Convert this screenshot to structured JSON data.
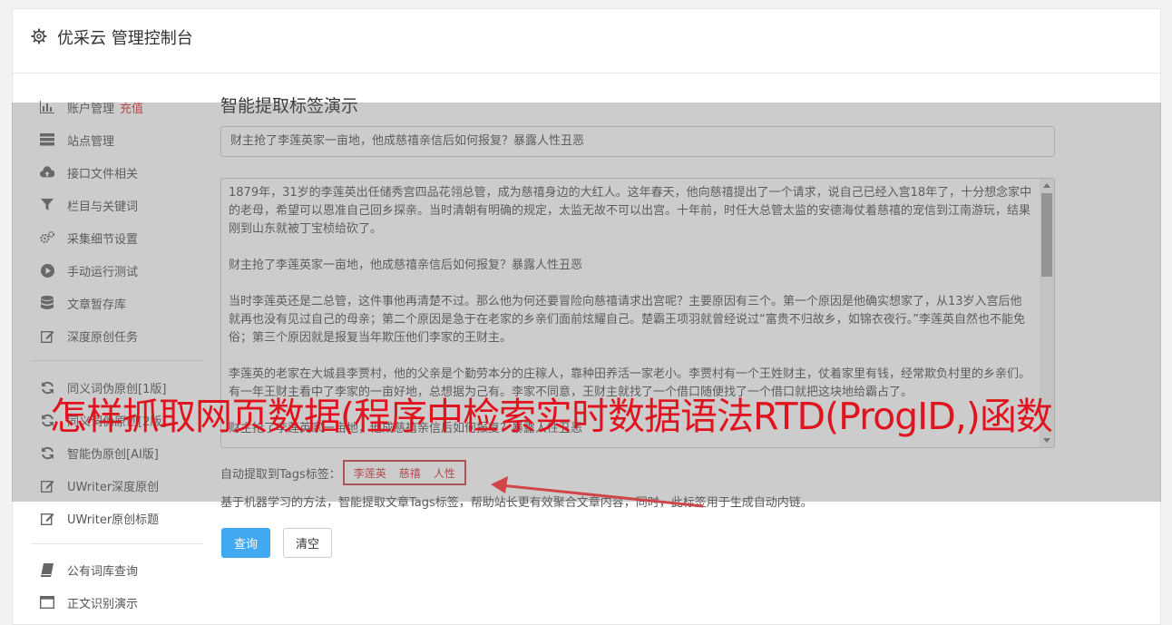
{
  "header": {
    "title": "优采云 管理控制台",
    "icon": "gear-icon"
  },
  "sidebar": {
    "items": [
      {
        "label": "账户管理",
        "highlight": "充值",
        "icon": "bar-chart-icon"
      },
      {
        "label": "站点管理",
        "icon": "server-icon"
      },
      {
        "label": "接口文件相关",
        "icon": "cloud-upload-icon"
      },
      {
        "label": "栏目与关键词",
        "icon": "filter-icon"
      },
      {
        "label": "采集细节设置",
        "icon": "cogs-icon"
      },
      {
        "label": "手动运行测试",
        "icon": "play-circle-icon"
      },
      {
        "label": "文章暂存库",
        "icon": "database-icon"
      },
      {
        "label": "深度原创任务",
        "icon": "edit-icon"
      },
      {
        "label": "同义词伪原创[1版]",
        "icon": "refresh-icon"
      },
      {
        "label": "同义词伪原创[2版]",
        "icon": "refresh-icon"
      },
      {
        "label": "智能伪原创[AI版]",
        "icon": "refresh-icon"
      },
      {
        "label": "UWriter深度原创",
        "icon": "edit-icon"
      },
      {
        "label": "UWriter原创标题",
        "icon": "edit-icon"
      },
      {
        "label": "公有词库查询",
        "icon": "book-icon"
      },
      {
        "label": "正文识别演示",
        "icon": "window-icon"
      }
    ]
  },
  "main": {
    "title": "智能提取标签演示",
    "title_input": "财主抢了李莲英家一亩地，他成慈禧亲信后如何报复？暴露人性丑恶",
    "content_paragraphs": [
      "1879年，31岁的李莲英出任储秀宫四品花翎总管，成为慈禧身边的大红人。这年春天，他向慈禧提出了一个请求，说自己已经入宫18年了，十分想念家中的老母，希望可以恩准自己回乡探亲。当时清朝有明确的规定，太监无故不可以出宫。十年前，时任大总管太监的安德海仗着慈禧的宠信到江南游玩，结果刚到山东就被丁宝桢给砍了。",
      "财主抢了李莲英家一亩地，他成慈禧亲信后如何报复？暴露人性丑恶",
      "当时李莲英还是二总管，这件事他再清楚不过。那么他为何还要冒险向慈禧请求出宫呢？主要原因有三个。第一个原因是他确实想家了，从13岁入宫后他就再也没有见过自己的母亲；第二个原因是急于在老家的乡亲们面前炫耀自己。楚霸王项羽就曾经说过“富贵不归故乡，如锦衣夜行。”李莲英自然也不能免俗；第三个原因就是报复当年欺压他们李家的王财主。",
      "李莲英的老家在大城县李贾村，他的父亲是个勤劳本分的庄稼人，靠种田养活一家老小。李贾村有一个王姓财主，仗着家里有钱，经常欺负村里的乡亲们。有一年王财主看中了李家的一亩好地，总想据为己有。李家不同意，王财主就找了一个借口随便找了一个借口就把这块地给霸占了。",
      "财主抢了李莲英家一亩地，他成慈禧亲信后如何报复？暴露人性丑恶"
    ],
    "tags_label": "自动提取到Tags标签：",
    "tags": [
      "李莲英",
      "慈禧",
      "人性"
    ],
    "help_text": "基于机器学习的方法，智能提取文章Tags标签，帮助站长更有效聚合文章内容，同时，此标签用于生成自动内链。",
    "query_button": "查询",
    "clear_button": "清空"
  },
  "banner": {
    "text": "怎样抓取网页数据(程序中检索实时数据语法RTD(ProgID,)函数",
    "color": "#e0141e"
  },
  "colors": {
    "accent": "#41a9f2",
    "tag": "#d9363e",
    "highlight": "#e4393c"
  }
}
